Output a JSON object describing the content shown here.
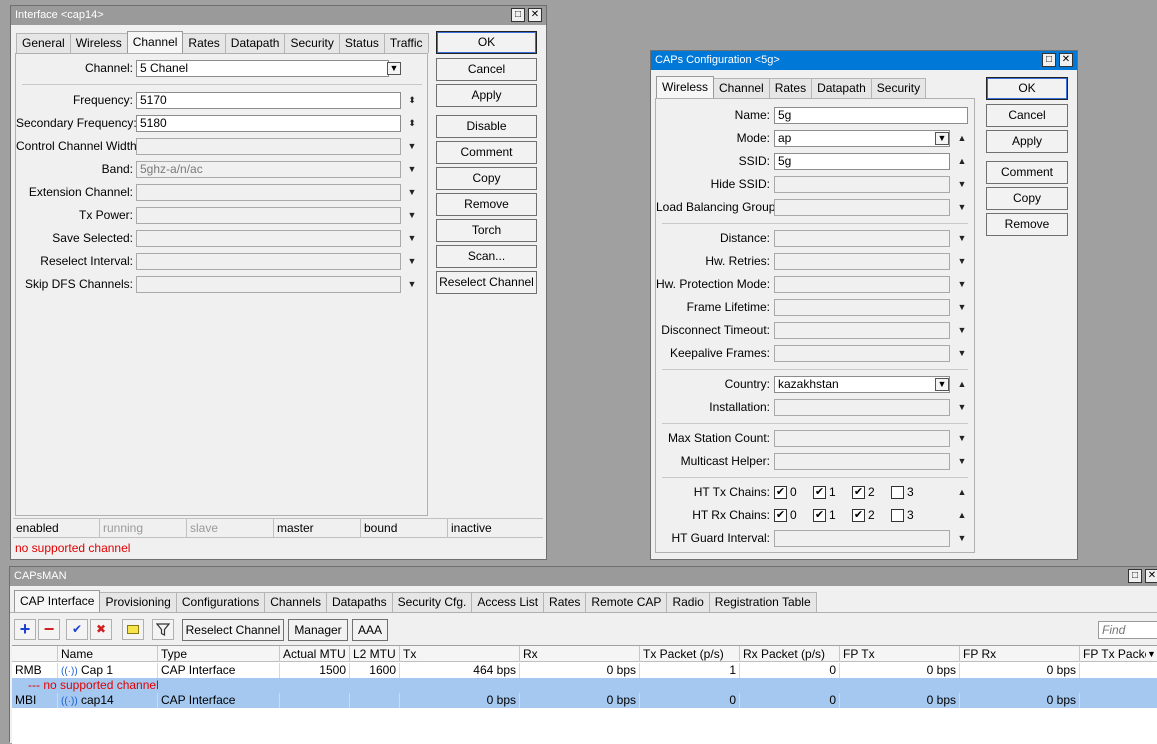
{
  "interface_window": {
    "title": "Interface <cap14>",
    "tabs": [
      "General",
      "Wireless",
      "Channel",
      "Rates",
      "Datapath",
      "Security",
      "Status",
      "Traffic"
    ],
    "active_tab": "Channel",
    "fields": {
      "channel": {
        "label": "Channel:",
        "value": "5 Chanel"
      },
      "frequency": {
        "label": "Frequency:",
        "value": "5170"
      },
      "secondary_frequency": {
        "label": "Secondary Frequency:",
        "value": "5180"
      },
      "control_channel_width": {
        "label": "Control Channel Width:",
        "value": ""
      },
      "band": {
        "label": "Band:",
        "value": "5ghz-a/n/ac"
      },
      "extension_channel": {
        "label": "Extension Channel:",
        "value": ""
      },
      "tx_power": {
        "label": "Tx Power:",
        "value": ""
      },
      "save_selected": {
        "label": "Save Selected:",
        "value": ""
      },
      "reselect_interval": {
        "label": "Reselect Interval:",
        "value": ""
      },
      "skip_dfs": {
        "label": "Skip DFS Channels:",
        "value": ""
      }
    },
    "buttons": {
      "ok": "OK",
      "cancel": "Cancel",
      "apply": "Apply",
      "disable": "Disable",
      "comment": "Comment",
      "copy": "Copy",
      "remove": "Remove",
      "torch": "Torch",
      "scan": "Scan...",
      "reselect": "Reselect Channel"
    },
    "status": {
      "enabled": "enabled",
      "running": "running",
      "slave": "slave",
      "master": "master",
      "bound": "bound",
      "inactive": "inactive"
    },
    "message": "no supported channel"
  },
  "caps_window": {
    "title": "CAPs Configuration <5g>",
    "tabs": [
      "Wireless",
      "Channel",
      "Rates",
      "Datapath",
      "Security"
    ],
    "active_tab": "Wireless",
    "fields": {
      "name": {
        "label": "Name:",
        "value": "5g"
      },
      "mode": {
        "label": "Mode:",
        "value": "ap"
      },
      "ssid": {
        "label": "SSID:",
        "value": "5g"
      },
      "hide_ssid": {
        "label": "Hide SSID:",
        "value": ""
      },
      "load_balancing": {
        "label": "Load Balancing Group:",
        "value": ""
      },
      "distance": {
        "label": "Distance:",
        "value": ""
      },
      "hw_retries": {
        "label": "Hw. Retries:",
        "value": ""
      },
      "hw_protection": {
        "label": "Hw. Protection Mode:",
        "value": ""
      },
      "frame_lifetime": {
        "label": "Frame Lifetime:",
        "value": ""
      },
      "disconnect_timeout": {
        "label": "Disconnect Timeout:",
        "value": ""
      },
      "keepalive": {
        "label": "Keepalive Frames:",
        "value": ""
      },
      "country": {
        "label": "Country:",
        "value": "kazakhstan"
      },
      "installation": {
        "label": "Installation:",
        "value": ""
      },
      "max_station": {
        "label": "Max Station Count:",
        "value": ""
      },
      "multicast_helper": {
        "label": "Multicast Helper:",
        "value": ""
      },
      "ht_tx_chains": {
        "label": "HT Tx Chains:"
      },
      "ht_rx_chains": {
        "label": "HT Rx Chains:"
      },
      "ht_guard": {
        "label": "HT Guard Interval:",
        "value": ""
      }
    },
    "chains": {
      "c0": "0",
      "c1": "1",
      "c2": "2",
      "c3": "3"
    },
    "buttons": {
      "ok": "OK",
      "cancel": "Cancel",
      "apply": "Apply",
      "comment": "Comment",
      "copy": "Copy",
      "remove": "Remove"
    }
  },
  "capsman_window": {
    "title": "CAPsMAN",
    "tabs": [
      "CAP Interface",
      "Provisioning",
      "Configurations",
      "Channels",
      "Datapaths",
      "Security Cfg.",
      "Access List",
      "Rates",
      "Remote CAP",
      "Radio",
      "Registration Table"
    ],
    "active_tab": "CAP Interface",
    "toolbar": {
      "reselect": "Reselect Channel",
      "manager": "Manager",
      "aaa": "AAA",
      "find_placeholder": "Find"
    },
    "columns": [
      "Name",
      "Type",
      "Actual MTU",
      "L2 MTU",
      "Tx",
      "Rx",
      "Tx Packet (p/s)",
      "Rx Packet (p/s)",
      "FP Tx",
      "FP Rx",
      "FP Tx Packe"
    ],
    "rows": [
      {
        "flag": "RMB",
        "name": "Cap 1",
        "type": "CAP Interface",
        "mtu": "1500",
        "l2mtu": "1600",
        "tx": "464 bps",
        "rx": "0 bps",
        "txp": "1",
        "rxp": "0",
        "fptx": "0 bps",
        "fprx": "0 bps"
      },
      {
        "flag": "MBI",
        "name": "cap14",
        "type": "CAP Interface",
        "mtu": "",
        "l2mtu": "",
        "tx": "0 bps",
        "rx": "0 bps",
        "txp": "0",
        "rxp": "0",
        "fptx": "0 bps",
        "fprx": "0 bps"
      }
    ],
    "row_comment": "--- no supported channel"
  },
  "colors": {
    "accent": "#0078d7",
    "selection": "#a4c8f0",
    "error": "#e00000"
  }
}
